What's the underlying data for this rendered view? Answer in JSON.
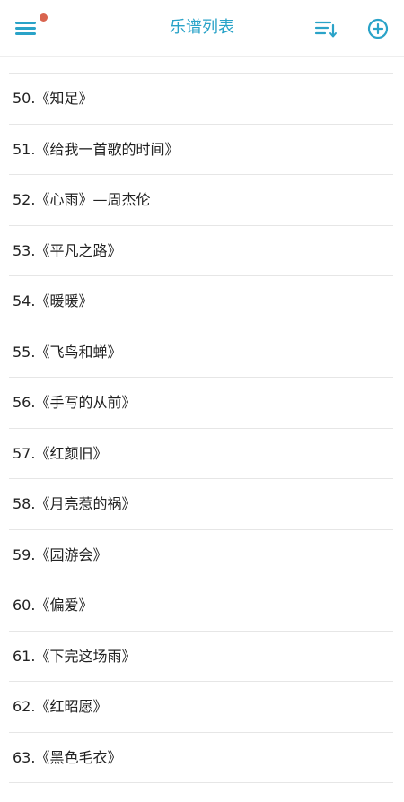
{
  "header": {
    "title": "乐谱列表",
    "menu_icon": "hamburger-menu-icon",
    "sort_icon": "sort-list-icon",
    "add_icon": "add-circle-icon",
    "accent_color": "#2aa3c8",
    "notification_dot_color": "#d9644f"
  },
  "songs": [
    "50.《知足》",
    "51.《给我一首歌的时间》",
    "52.《心雨》—周杰伦",
    "53.《平凡之路》",
    "54.《暖暖》",
    "55.《飞鸟和蝉》",
    "56.《手写的从前》",
    "57.《红颜旧》",
    "58.《月亮惹的祸》",
    "59.《园游会》",
    "60.《偏爱》",
    "61.《下完这场雨》",
    "62.《红昭愿》",
    "63.《黑色毛衣》"
  ]
}
